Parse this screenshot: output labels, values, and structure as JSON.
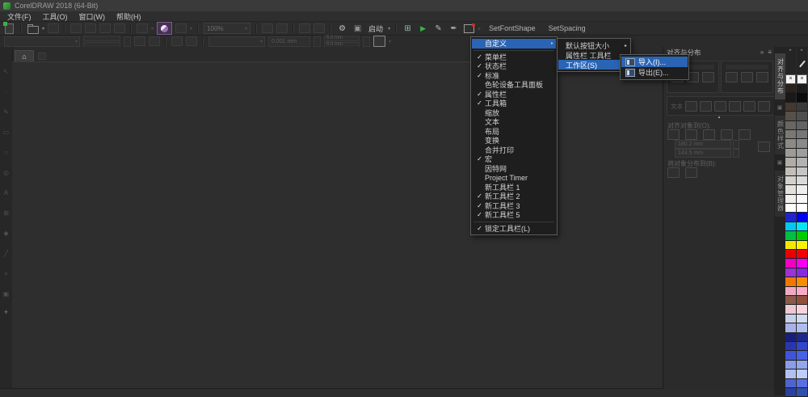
{
  "glyphs": {
    "check": "✓",
    "submenu_arrow": "▸",
    "dropdown_arrow": "▾",
    "play": "▶",
    "home": "⌂",
    "gear": "⚙",
    "grid": "⊞",
    "pencil": "✎",
    "pen": "✒",
    "window": "▣",
    "no_color": "×",
    "up_arrow": "▴",
    "right_arrow": "▸",
    "menu_lines": "≡",
    "collapse": "»",
    "tab_icon": "▣",
    "plus": "+"
  },
  "titlebar": {
    "title": "CorelDRAW 2018 (64-Bit)"
  },
  "menubar": {
    "items": [
      "文件(F)",
      "工具(O)",
      "窗口(W)",
      "帮助(H)"
    ]
  },
  "toolbar": {
    "zoom_value": "100%",
    "launch_label": "启动",
    "macros": [
      "SetFontShape",
      "SetSpacing"
    ]
  },
  "propbar": {
    "nudge_value": "0.001 mm",
    "duplicate_x": "5.0 mm",
    "duplicate_y": "5.0 mm"
  },
  "context_menu": {
    "header_label": "自定义",
    "items": [
      {
        "label": "菜单栏",
        "checked": true
      },
      {
        "label": "状态栏",
        "checked": true
      },
      {
        "label": "标准",
        "checked": true
      },
      {
        "label": "色轮设备工具面板",
        "checked": false
      },
      {
        "label": "属性栏",
        "checked": true
      },
      {
        "label": "工具箱",
        "checked": true
      },
      {
        "label": "缩放",
        "checked": false
      },
      {
        "label": "文本",
        "checked": false
      },
      {
        "label": "布局",
        "checked": false
      },
      {
        "label": "变换",
        "checked": false
      },
      {
        "label": "合并打印",
        "checked": false
      },
      {
        "label": "宏",
        "checked": true
      },
      {
        "label": "因特网",
        "checked": false
      },
      {
        "label": "Project Timer",
        "checked": false
      },
      {
        "label": "新工具栏 1",
        "checked": false
      },
      {
        "label": "新工具栏 2",
        "checked": true
      },
      {
        "label": "新工具栏 3",
        "checked": true
      },
      {
        "label": "新工具栏 5",
        "checked": true
      }
    ],
    "footer_label": "锁定工具栏(L)",
    "footer_checked": true
  },
  "customize_submenu": {
    "items": [
      {
        "label": "默认按钮大小",
        "highlighted": false
      },
      {
        "label": "属性栏 工具栏",
        "highlighted": false
      },
      {
        "label": "工作区(S)",
        "highlighted": true
      }
    ]
  },
  "workspace_submenu": {
    "items": [
      {
        "label": "导入(I)...",
        "highlighted": true
      },
      {
        "label": "导出(E)...",
        "highlighted": false
      }
    ]
  },
  "docker": {
    "title": "对齐与分布",
    "text_label": "文本",
    "align_to_header": "对齐对象到(O):",
    "distribute_to_header": "将对象分布到(B):",
    "x_value": "180.2 mm",
    "y_value": "143.5 mm",
    "tabs": [
      {
        "label": "对齐与分布",
        "active": true
      },
      {
        "label": "颜色样式",
        "active": false
      },
      {
        "label": "对象管理器",
        "active": false
      }
    ]
  },
  "toolbox": {
    "tools": [
      {
        "name": "pick-tool",
        "glyph": "↖"
      },
      {
        "name": "shape-tool",
        "glyph": "◌"
      },
      {
        "name": "freehand-tool",
        "glyph": "✎"
      },
      {
        "name": "rectangle-tool",
        "glyph": "▭"
      },
      {
        "name": "ellipse-tool",
        "glyph": "○"
      },
      {
        "name": "zoom-tool",
        "glyph": "◎"
      },
      {
        "name": "text-tool",
        "glyph": "A"
      },
      {
        "name": "table-tool",
        "glyph": "⊞"
      },
      {
        "name": "fill-tool",
        "glyph": "◆"
      },
      {
        "name": "line-tool",
        "glyph": "╱"
      },
      {
        "name": "eraser-tool",
        "glyph": "×"
      },
      {
        "name": "outline-tool",
        "glyph": "▣"
      }
    ]
  },
  "palettes": {
    "left": [
      "#2b221c",
      "#191919",
      "#46382e",
      "#565049",
      "#696661",
      "#7b7873",
      "#8d8a85",
      "#9e9b96",
      "#b0ada8",
      "#c2bfba",
      "#d4d1cc",
      "#e5e2de",
      "#f2f0ed",
      "#ffffff",
      "#2222cc",
      "#00c8f0",
      "#00c042",
      "#f5e800",
      "#e80000",
      "#f000c0",
      "#9c32d8",
      "#f07800",
      "#f0aac0",
      "#8a5a4a",
      "#ecc8d4",
      "#c6d0e8",
      "#a8b2e8",
      "#16207a",
      "#2a36b0",
      "#4054d8",
      "#8c9ce8",
      "#b2c0f0",
      "#5064d0",
      "#2840a0"
    ],
    "right": [
      "#1c1c1c",
      "#0c0c0c",
      "#3a3a3a",
      "#4e4e4e",
      "#626262",
      "#767676",
      "#8a8a8a",
      "#9e9e9e",
      "#b2b2b2",
      "#c6c6c6",
      "#dadada",
      "#eeeeee",
      "#f8f8f8",
      "#ffffff",
      "#0000f0",
      "#00e8f8",
      "#00cc00",
      "#f8f400",
      "#f40000",
      "#f800f0",
      "#8828e0",
      "#f88c00",
      "#f8aac8",
      "#90503c",
      "#f8d2dc",
      "#d0daf0",
      "#b0bcf0",
      "#1c2888",
      "#3048cc",
      "#4862e8",
      "#94a6f0",
      "#bccef8",
      "#5a70e0",
      "#3050b0"
    ]
  },
  "colors": {
    "menu_highlight": "#2a64b4",
    "play_green": "#35b34a",
    "launch_purple": "#9b6fb5"
  }
}
